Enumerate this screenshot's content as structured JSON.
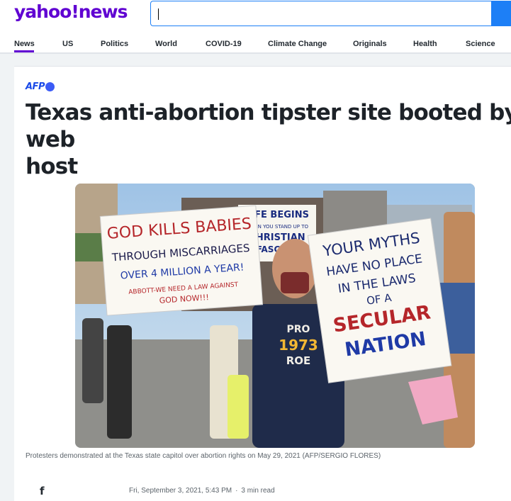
{
  "header": {
    "logo_text": "yahoo",
    "logo_bang": "!",
    "logo_suffix": "news",
    "search": {
      "placeholder": "",
      "value": ""
    }
  },
  "nav": {
    "items": [
      {
        "label": "News",
        "active": true
      },
      {
        "label": "US"
      },
      {
        "label": "Politics"
      },
      {
        "label": "World"
      },
      {
        "label": "COVID-19"
      },
      {
        "label": "Climate Change"
      },
      {
        "label": "Originals"
      },
      {
        "label": "Health"
      },
      {
        "label": "Science"
      }
    ]
  },
  "article": {
    "source": "AFP",
    "headline_line1": "Texas anti-abortion tipster site booted by web",
    "headline_line2": "host",
    "image": {
      "sign_left": [
        "GOD KILLS BABIES",
        "THROUGH MISCARRIAGES",
        "OVER 4 MILLION A YEAR!",
        "ABBOTT-WE NEED A LAW AGAINST",
        "GOD NOW!!!"
      ],
      "sign_right": [
        "YOUR MYTHS",
        "HAVE NO PLACE",
        "IN THE LAWS",
        "OF A",
        "SECULAR",
        "NATION"
      ],
      "sign_back": [
        "LIFE BEGINS",
        "WHEN YOU STAND UP TO",
        "CHRISTIAN",
        "FASCISM"
      ],
      "shirt": [
        "PRO",
        "1973",
        "ROE"
      ]
    },
    "caption": "Protesters demonstrated at the Texas state capitol over abortion rights on May 29, 2021 (AFP/SERGIO FLORES)",
    "share_icon": "facebook-icon",
    "date": "Fri, September 3, 2021, 5:43 PM",
    "separator": "·",
    "read_time": "3 min read"
  },
  "colors": {
    "brand": "#6001d2",
    "search_accent": "#1d7ff6",
    "source_blue": "#1a4ae8"
  }
}
